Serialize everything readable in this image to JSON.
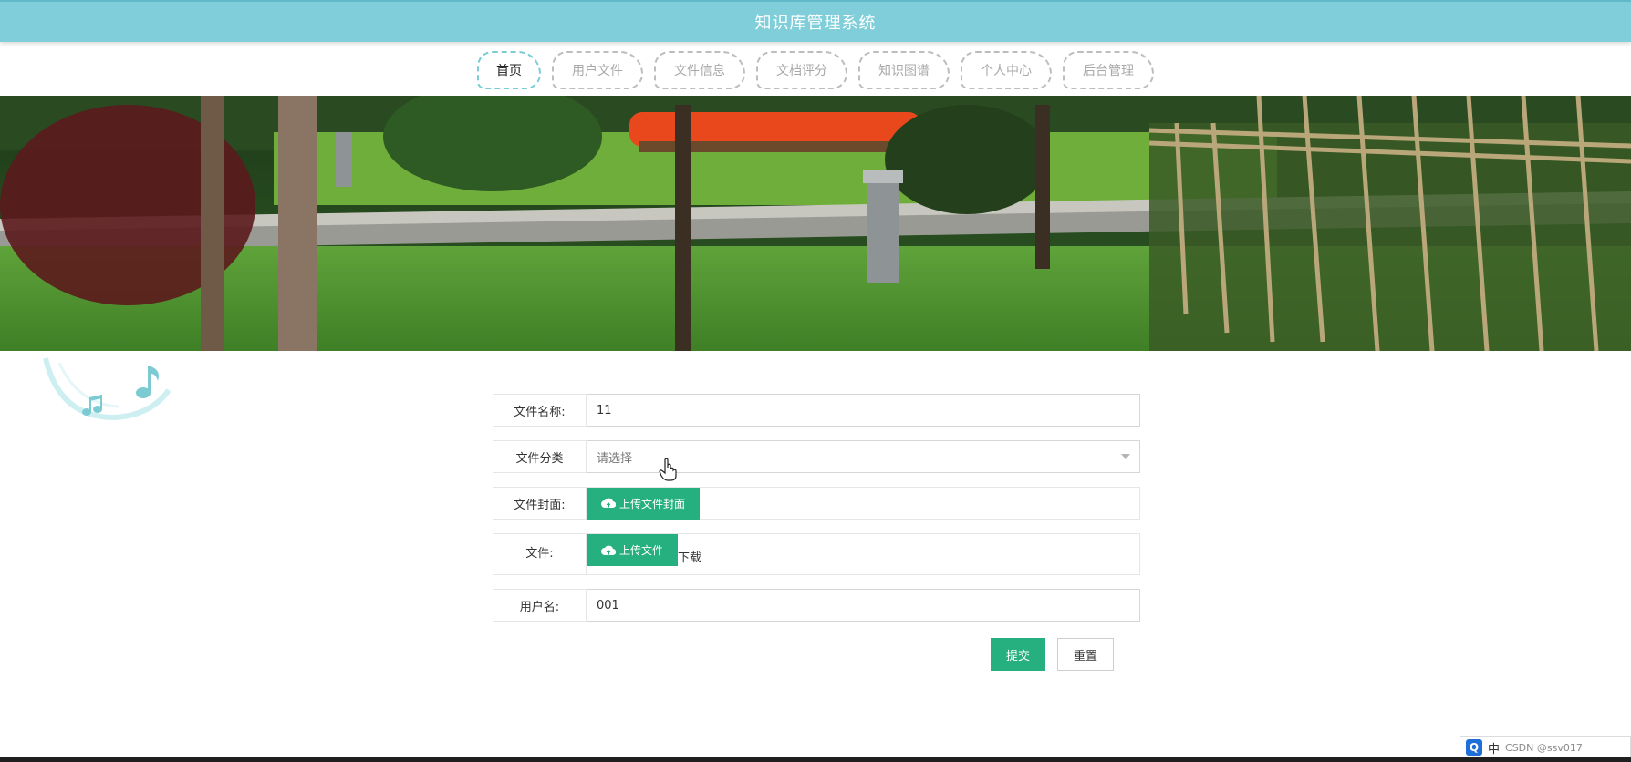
{
  "header": {
    "title": "知识库管理系统"
  },
  "nav": {
    "items": [
      {
        "label": "首页",
        "active": true
      },
      {
        "label": "用户文件"
      },
      {
        "label": "文件信息"
      },
      {
        "label": "文档评分"
      },
      {
        "label": "知识图谱"
      },
      {
        "label": "个人中心"
      },
      {
        "label": "后台管理"
      }
    ]
  },
  "form": {
    "name_label": "文件名称:",
    "name_value": "11",
    "category_label": "文件分类",
    "category_placeholder": "请选择",
    "cover_label": "文件封面:",
    "cover_button": "上传文件封面",
    "file_label": "文件:",
    "file_button": "上传文件",
    "download_link": "下载",
    "username_label": "用户名:",
    "username_value": "001",
    "submit": "提交",
    "reset": "重置"
  },
  "tray": {
    "input_method": "中",
    "watermark": "CSDN @ssv017"
  },
  "colors": {
    "header": "#80ced9",
    "accent": "#26b07f",
    "nav_active_border": "#7cccd6"
  },
  "icons": {
    "upload": "cloud-upload-icon",
    "select": "chevron-down-icon",
    "decoration": "music-note-icon"
  }
}
